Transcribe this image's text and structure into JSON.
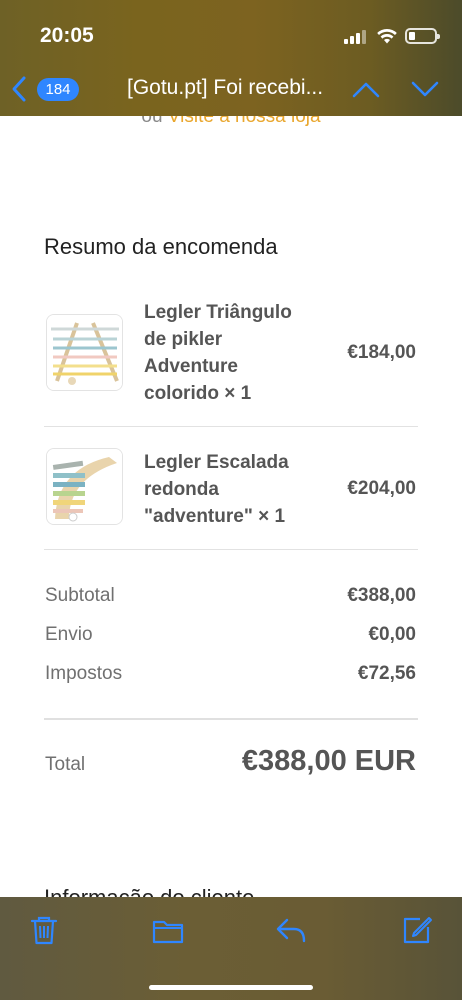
{
  "status_bar": {
    "time": "20:05",
    "battery_level": 0.2
  },
  "nav": {
    "unread_count": "184",
    "subject": "[Gotu.pt] Foi recebi..."
  },
  "content": {
    "partial_text_prefix": "ou ",
    "partial_text_link": "Visite a nossa loja",
    "section_title": "Resumo da encomenda",
    "items": [
      {
        "name": "Legler Triângulo de pikler Adventure colorido × 1",
        "price": "€184,00"
      },
      {
        "name": "Legler Escalada redonda \"adventure\" × 1",
        "price": "€204,00"
      }
    ],
    "summary": [
      {
        "label": "Subtotal",
        "value": "€388,00"
      },
      {
        "label": "Envio",
        "value": "€0,00"
      },
      {
        "label": "Impostos",
        "value": "€72,56"
      }
    ],
    "total": {
      "label": "Total",
      "value": "€388,00 EUR"
    },
    "next_section_title": "Informação do cliente"
  },
  "toolbar": {
    "icons": [
      "trash-icon",
      "folder-icon",
      "reply-icon",
      "compose-icon"
    ]
  },
  "colors": {
    "accent_blue": "#2f86ff",
    "link_orange": "#e9a62c",
    "bar_background": "#6e6126"
  }
}
